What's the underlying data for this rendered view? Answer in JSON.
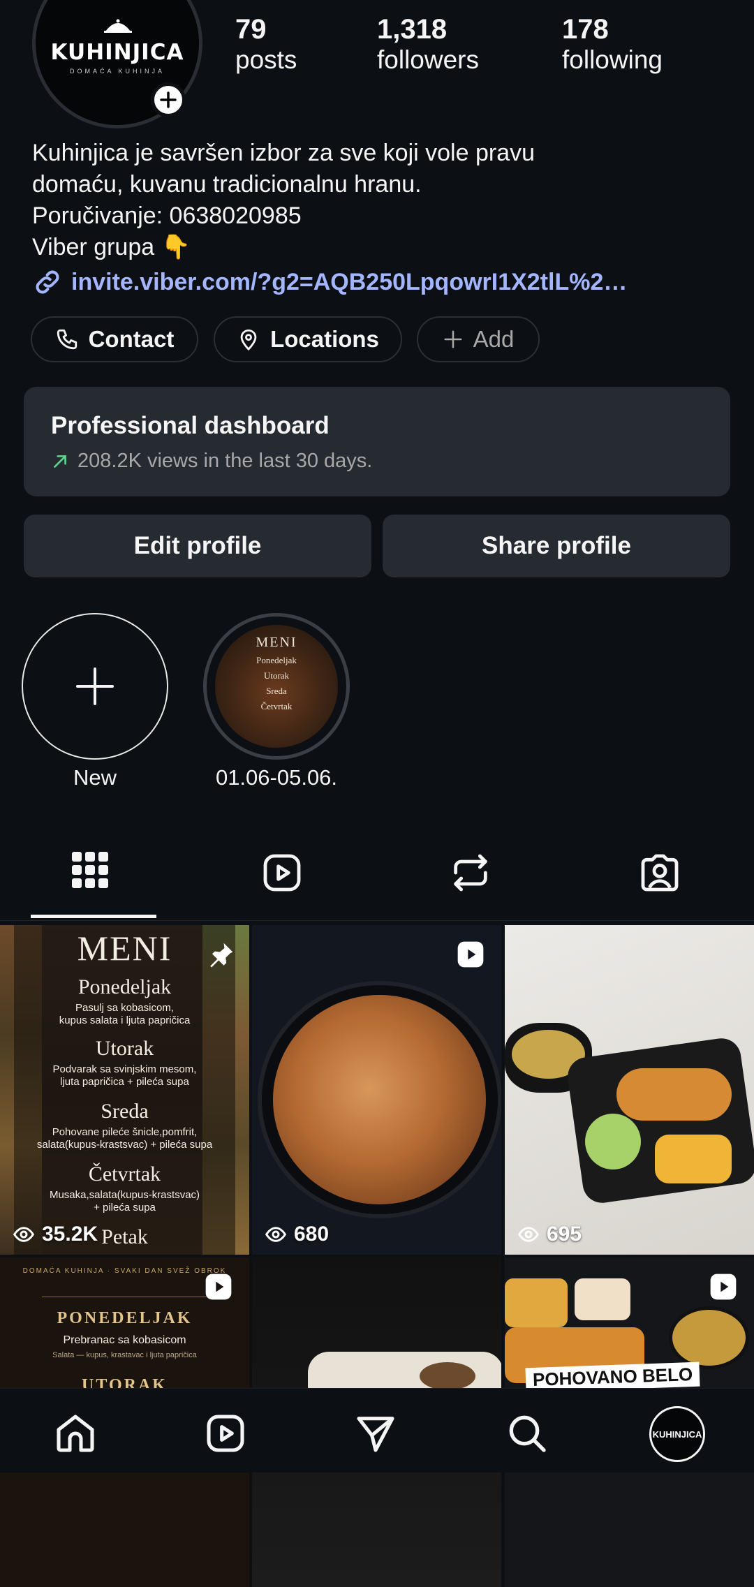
{
  "profile": {
    "logo_text": "KUHINJICA",
    "logo_sub": "DOMAĆA KUHINJA",
    "stats": [
      {
        "num": "79",
        "label": "posts"
      },
      {
        "num": "1,318",
        "label": "followers"
      },
      {
        "num": "178",
        "label": "following"
      }
    ],
    "bio_lines": [
      "Kuhinjica je savršen izbor za sve koji vole pravu",
      "domaću, kuvanu tradicionalnu hranu.",
      "Poručivanje: 0638020985",
      "Viber grupa 👇"
    ],
    "link": "invite.viber.com/?g2=AQB250LpqowrI1X2tlL%2…"
  },
  "chips": {
    "contact": "Contact",
    "locations": "Locations",
    "add": "Add"
  },
  "dashboard": {
    "title": "Professional dashboard",
    "subtitle": "208.2K views in the last 30 days."
  },
  "buttons": {
    "edit": "Edit profile",
    "share": "Share profile"
  },
  "highlights": {
    "new_label": "New",
    "story_label": "01.06-05.06.",
    "story_thumb": {
      "title": "MENI",
      "day": "Ponedeljak",
      "d2": "Utorak",
      "d3": "Sreda",
      "d4": "Četvrtak"
    }
  },
  "grid": {
    "post1": {
      "views": "35.2K",
      "title": "MENI",
      "days": [
        {
          "day": "Ponedeljak",
          "dish": "Pasulj sa kobasicom,",
          "dish2": "kupus salata i ljuta papričica"
        },
        {
          "day": "Utorak",
          "dish": "Podvarak sa svinjskim mesom,",
          "dish2": "ljuta papričica + pileća supa"
        },
        {
          "day": "Sreda",
          "dish": "Pohovane pileće šnicle,pomfrit,",
          "dish2": "salata(kupus-krastsvac) + pileća supa"
        },
        {
          "day": "Četvrtak",
          "dish": "Musaka,salata(kupus-krastsvac)",
          "dish2": "+ pileća supa"
        },
        {
          "day": "Petak",
          "dish": "",
          "dish2": ""
        }
      ]
    },
    "post2": {
      "views": "680"
    },
    "post3": {
      "views": "695"
    },
    "post4": {
      "tagline": "DOMAĆA KUHINJA · SVAKI DAN SVEŽ OBROK",
      "day1": "PONEDELJAK",
      "dish1": "Prebranac sa kobasicom",
      "dish1b": "Salata — kupus, krastavac i ljuta papričica",
      "day2": "UTORAK"
    },
    "post6": {
      "banner": "POHOVANO BELO"
    }
  },
  "nav": {
    "avatar_text": "KUHINJICA"
  },
  "colors": {
    "background": "#0c1014",
    "card": "#262a31",
    "link": "#a3b6ff",
    "trend_green": "#5fd38b"
  }
}
